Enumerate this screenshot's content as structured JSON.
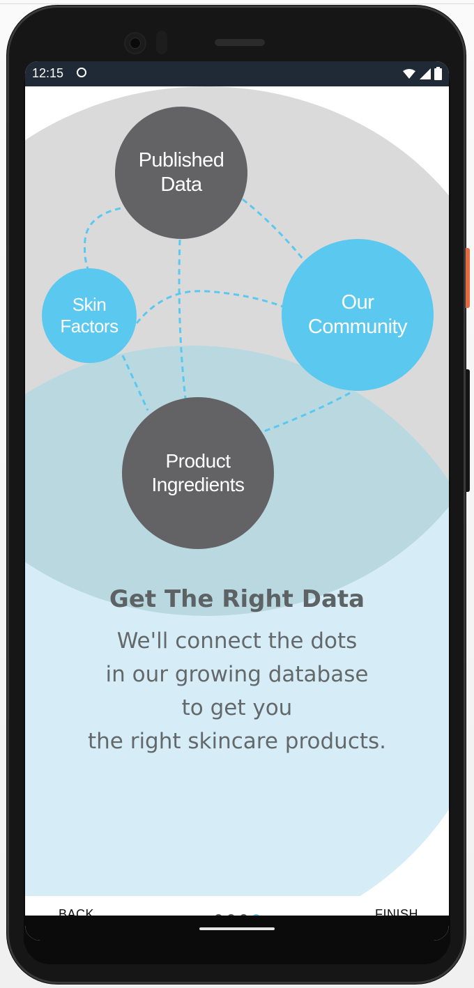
{
  "status_bar": {
    "time": "12:15",
    "icons": [
      "notification-icon",
      "wifi-icon",
      "signal-icon",
      "battery-icon"
    ]
  },
  "graph": {
    "nodes": [
      {
        "id": "published",
        "label": "Published\nData",
        "color": "#636365"
      },
      {
        "id": "skin",
        "label": "Skin\nFactors",
        "color": "#5bc8ef"
      },
      {
        "id": "community",
        "label": "Our\nCommunity",
        "color": "#5bc8ef"
      },
      {
        "id": "ingredients",
        "label": "Product\nIngredients",
        "color": "#636365"
      }
    ]
  },
  "onboarding": {
    "title": "Get The Right Data",
    "body_lines": [
      "We'll connect the dots",
      "in our growing database",
      "to get you",
      "the right skincare products."
    ]
  },
  "footer": {
    "back_label": "BACK",
    "finish_label": "FINISH",
    "pager": {
      "total": 4,
      "current": 4
    }
  },
  "colors": {
    "accent": "#5bc8ef",
    "dark_node": "#636365",
    "grey_blob": "#dadada",
    "blue_blob": "#d6edf7"
  }
}
